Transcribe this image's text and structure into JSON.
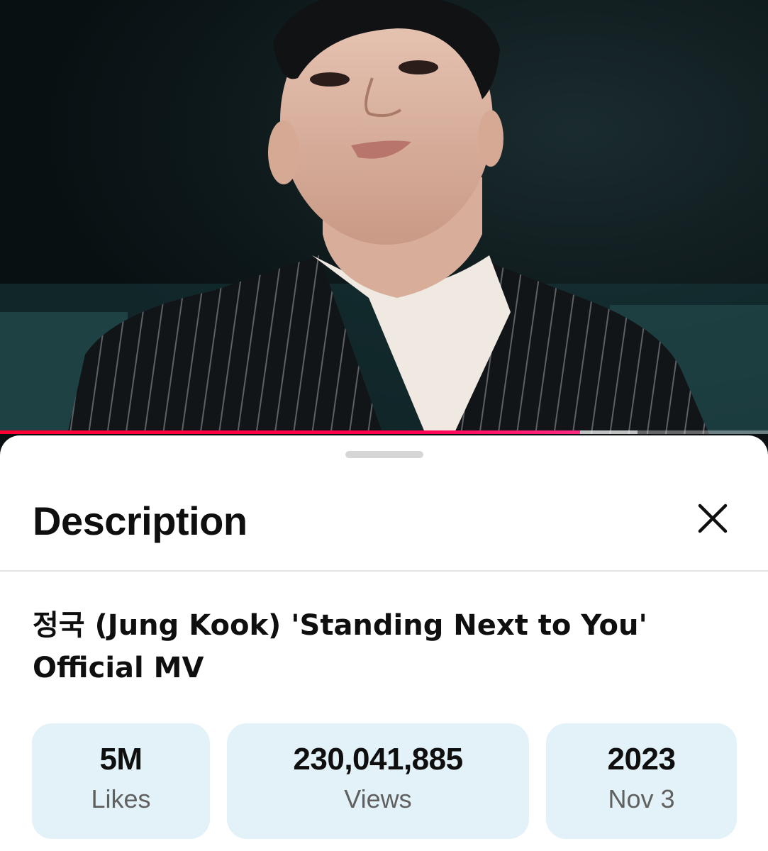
{
  "video": {
    "thumbnail_description": "Music video frame",
    "progress_fraction": 0.755,
    "buffered_fraction": 0.83,
    "progress_color": "#ff0033"
  },
  "sheet": {
    "heading": "Description",
    "close_icon": "close-icon",
    "video_title": "정국 (Jung Kook) 'Standing Next to You' Official MV",
    "stats": [
      {
        "value": "5M",
        "label": "Likes"
      },
      {
        "value": "230,041,885",
        "label": "Views"
      },
      {
        "value": "2023",
        "label": "Nov 3"
      }
    ],
    "stat_background": "#e3f2f8"
  }
}
